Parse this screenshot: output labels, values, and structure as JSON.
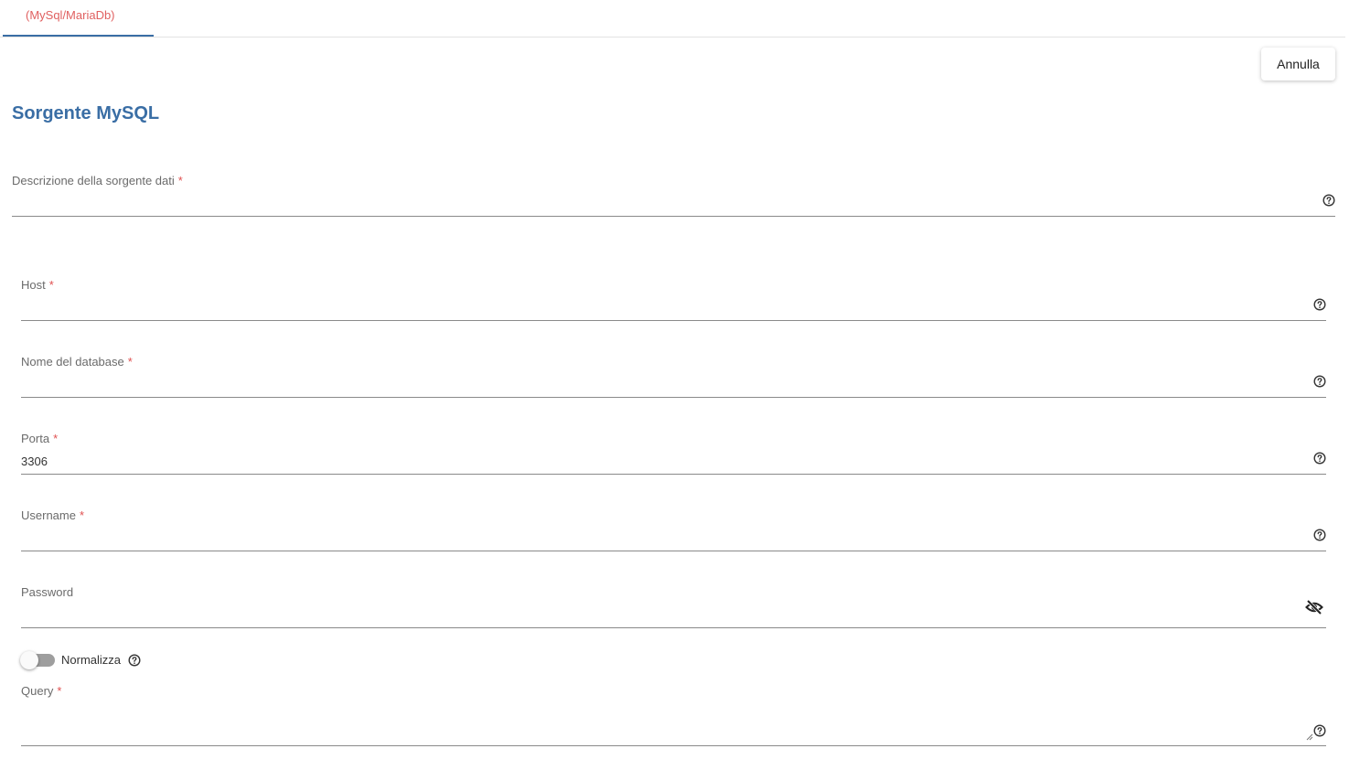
{
  "tabs": [
    {
      "label": "(MySql/MariaDb)",
      "active": true
    }
  ],
  "toolbar": {
    "cancel_label": "Annulla"
  },
  "page_title": "Sorgente MySQL",
  "fields": {
    "description": {
      "label": "Descrizione della sorgente dati",
      "required_mark": "*",
      "value": ""
    },
    "host": {
      "label": "Host",
      "required_mark": "*",
      "value": ""
    },
    "database": {
      "label": "Nome del database",
      "required_mark": "*",
      "value": ""
    },
    "port": {
      "label": "Porta",
      "required_mark": "*",
      "value": "3306"
    },
    "username": {
      "label": "Username",
      "required_mark": "*",
      "value": ""
    },
    "password": {
      "label": "Password",
      "value": ""
    },
    "query": {
      "label": "Query",
      "required_mark": "*",
      "value": ""
    }
  },
  "normalize": {
    "label": "Normalizza",
    "enabled": false
  },
  "colors": {
    "accent": "#3a6ea5",
    "required": "#e05050",
    "tab_text": "#e06060"
  },
  "icons": {
    "help": "help-circle-icon",
    "password_visibility": "eye-off-icon"
  }
}
